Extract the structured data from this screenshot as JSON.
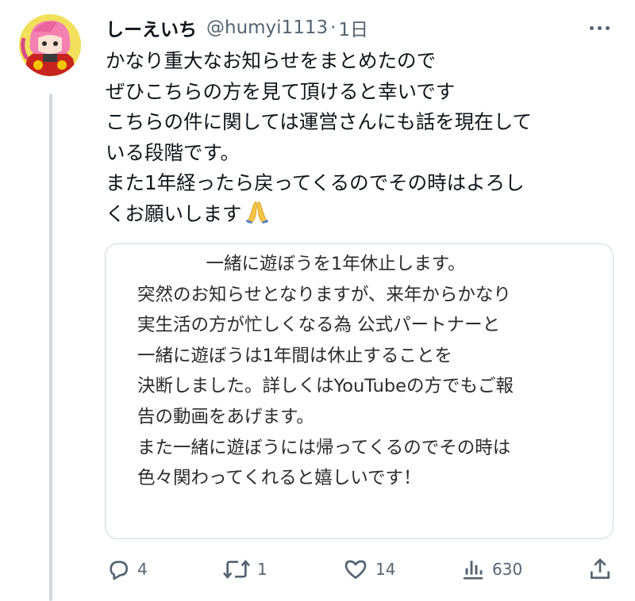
{
  "tweet": {
    "author_name": "しーえいち",
    "handle": "@humyi1113",
    "separator": "·",
    "time": "1日",
    "text_lines": [
      "かなり重大なお知らせをまとめたので",
      "ぜひこちらの方を見て頂けると幸いです",
      "こちらの件に関しては運営さんにも話を現在して",
      "いる段階です。",
      "また1年経ったら戻ってくるのでその時はよろし",
      "くお願いします"
    ],
    "emoji": "folded-hands"
  },
  "image_text": {
    "title": "一緒に遊ぼうを1年休止します。",
    "lines": [
      "突然のお知らせとなりますが、来年からかなり",
      "実生活の方が忙しくなる為 公式パートナーと",
      "一緒に遊ぼうは1年間は休止することを",
      "決断しました。詳しくはYouTubeの方でもご報",
      "告の動画をあげます。",
      "また一緒に遊ぼうには帰ってくるのでその時は",
      "色々関わってくれると嬉しいです！"
    ]
  },
  "actions": {
    "reply_count": "4",
    "retweet_count": "1",
    "like_count": "14",
    "view_count": "630"
  },
  "icons": {
    "reply": "reply-icon",
    "retweet": "retweet-icon",
    "like": "heart-icon",
    "views": "views-icon",
    "share": "share-icon",
    "more": "more-icon"
  },
  "colors": {
    "text": "#0f1419",
    "secondary": "#536471",
    "border": "#cfd9de"
  }
}
